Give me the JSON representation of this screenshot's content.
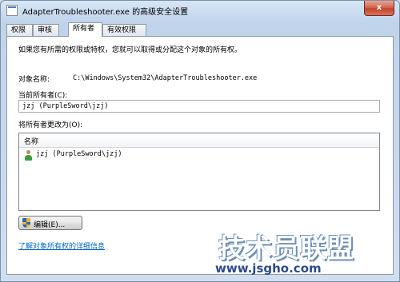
{
  "window": {
    "title": "AdapterTroubleshooter.exe 的高级安全设置",
    "close_label": "x"
  },
  "tabs": [
    {
      "label": "权限",
      "active": false
    },
    {
      "label": "审核",
      "active": false
    },
    {
      "label": "所有者",
      "active": true
    },
    {
      "label": "有效权限",
      "active": false
    }
  ],
  "owner_page": {
    "intro": "如果您有所需的权限或特权，您就可以取得或分配这个对象的所有权。",
    "object_name_label": "对象名称:",
    "object_name_value": "C:\\Windows\\System32\\AdapterTroubleshooter.exe",
    "current_owner_label": "当前所有者(C):",
    "current_owner_value": "jzj (PurpleSword\\jzj)",
    "change_owner_label": "将所有者更改为(O):",
    "list_header_name": "名称",
    "owner_list": [
      {
        "name": "jzj (PurpleSword\\jzj)",
        "icon": "user-icon"
      }
    ],
    "edit_button_label": "编辑(E)...",
    "edit_button_icon": "shield-icon",
    "learn_more_link": "了解对象所有权的详细信息"
  },
  "watermark": {
    "text": "技术员联盟",
    "url": "www.jsgho.com"
  }
}
